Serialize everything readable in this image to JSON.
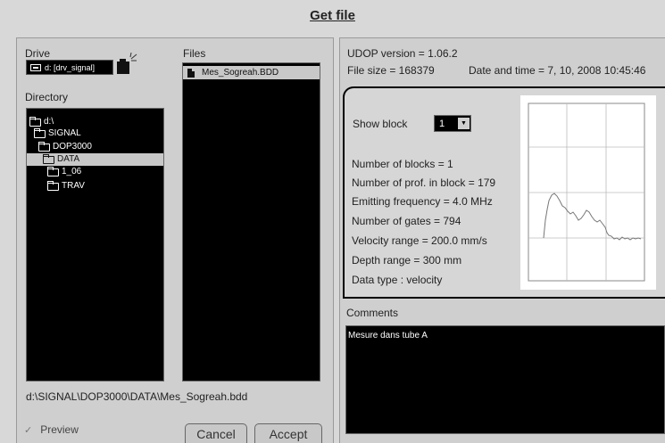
{
  "title": "Get file",
  "left": {
    "drive_label": "Drive",
    "drive_value": "d: [drv_signal]",
    "directory_label": "Directory",
    "directory": [
      {
        "label": "d:\\",
        "indent": 0,
        "open": true,
        "selected": false
      },
      {
        "label": "SIGNAL",
        "indent": 1,
        "open": true,
        "selected": false
      },
      {
        "label": "DOP3000",
        "indent": 2,
        "open": true,
        "selected": false
      },
      {
        "label": "DATA",
        "indent": 3,
        "open": true,
        "selected": true
      },
      {
        "label": "1_06",
        "indent": 4,
        "open": false,
        "selected": false
      },
      {
        "label": "TRAV",
        "indent": 4,
        "open": false,
        "selected": false
      }
    ],
    "files_label": "Files",
    "files": [
      "Mes_Sogreah.BDD"
    ],
    "path": "d:\\SIGNAL\\DOP3000\\DATA\\Mes_Sogreah.bdd",
    "preview_label": "Preview",
    "cancel_label": "Cancel",
    "accept_label": "Accept"
  },
  "right": {
    "udop_version": "UDOP version = 1.06.2",
    "file_size": "File size = 168379",
    "date_time": "Date and time = 7, 10, 2008  10:45:46",
    "show_block_label": "Show block",
    "show_block_value": "1",
    "stats": [
      "Number of blocks = 1",
      "Number of prof. in block = 179",
      "Emitting frequency = 4.0 MHz",
      "Number of gates = 794",
      "Velocity range = 200.0 mm/s",
      "Depth range = 300 mm",
      "Data type : velocity"
    ],
    "comments_label": "Comments",
    "comments_text": "Mesure dans tube A"
  },
  "colors": {
    "background": "#d8d8d8",
    "list_background": "#000000",
    "selection": "#c8c8c8"
  }
}
